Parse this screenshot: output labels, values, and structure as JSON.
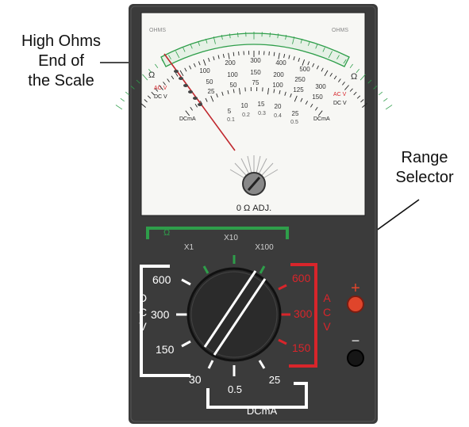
{
  "callouts": {
    "high_ohms": [
      "High Ohms",
      "End of",
      "the Scale"
    ],
    "range_selector": [
      "Range",
      "Selector"
    ]
  },
  "meter": {
    "ohms_left": "OHMS",
    "ohms_right": "OHMS",
    "omega_symbol": "Ω",
    "ohms_scale_marks": [
      "1k",
      "500",
      "200",
      "100",
      "50",
      "30",
      "20",
      "10",
      "5",
      "0"
    ],
    "scale_row_1": [
      "100",
      "200",
      "300",
      "400",
      "500"
    ],
    "scale_row_2": [
      "50",
      "100",
      "150",
      "200",
      "250",
      "300"
    ],
    "scale_row_3": [
      "25",
      "50",
      "75",
      "100",
      "125",
      "150"
    ],
    "dcma_scale": [
      "5",
      "10",
      "15",
      "20",
      "25"
    ],
    "dcma_scale_2": [
      "0.1",
      "0.2",
      "0.3",
      "0.4",
      "0.5"
    ],
    "acv_left": "AC V",
    "dcv_left": "DC V",
    "acv_right": "AC V",
    "dcv_right": "DC V",
    "dcma_left": "DCmA",
    "dcma_right": "DCmA",
    "zero_adj": "0 Ω ADJ."
  },
  "selector": {
    "ohm_label": "Ω",
    "ohm_ranges": [
      "X1",
      "X10",
      "X100"
    ],
    "dcv_letters": [
      "D",
      "C",
      "V"
    ],
    "dcv_values": [
      "600",
      "300",
      "150",
      "30"
    ],
    "acv_letters": [
      "A",
      "C",
      "V"
    ],
    "acv_values": [
      "600",
      "300",
      "150"
    ],
    "dcma_values": [
      "0.5",
      "25"
    ],
    "dcma_label": "DCmA",
    "plus_sign": "+",
    "minus_sign": "−"
  },
  "colors": {
    "case": "#3b3b3b",
    "face": "#f7f7f4",
    "ohm_bracket": "#2e9e4a",
    "acv_bracket": "#d8252b",
    "dcv_bracket": "#ffffff",
    "needle": "#c0272d",
    "plus_jack": "#e0452b",
    "minus_jack": "#161616"
  }
}
